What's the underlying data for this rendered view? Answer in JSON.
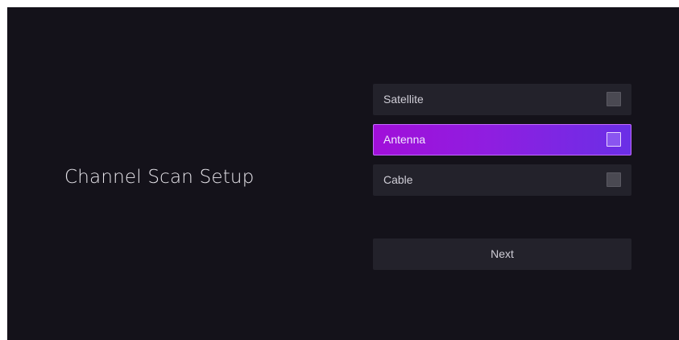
{
  "page": {
    "title": "Channel Scan Setup"
  },
  "options": [
    {
      "label": "Satellite",
      "checked": false,
      "focused": false
    },
    {
      "label": "Antenna",
      "checked": false,
      "focused": true
    },
    {
      "label": "Cable",
      "checked": false,
      "focused": false
    }
  ],
  "actions": {
    "next_label": "Next"
  },
  "colors": {
    "background": "#14121a",
    "item_background": "#23222b",
    "focus_gradient_start": "#a10fd9",
    "focus_gradient_end": "#6a2fe6",
    "text": "#cfcdd6"
  }
}
